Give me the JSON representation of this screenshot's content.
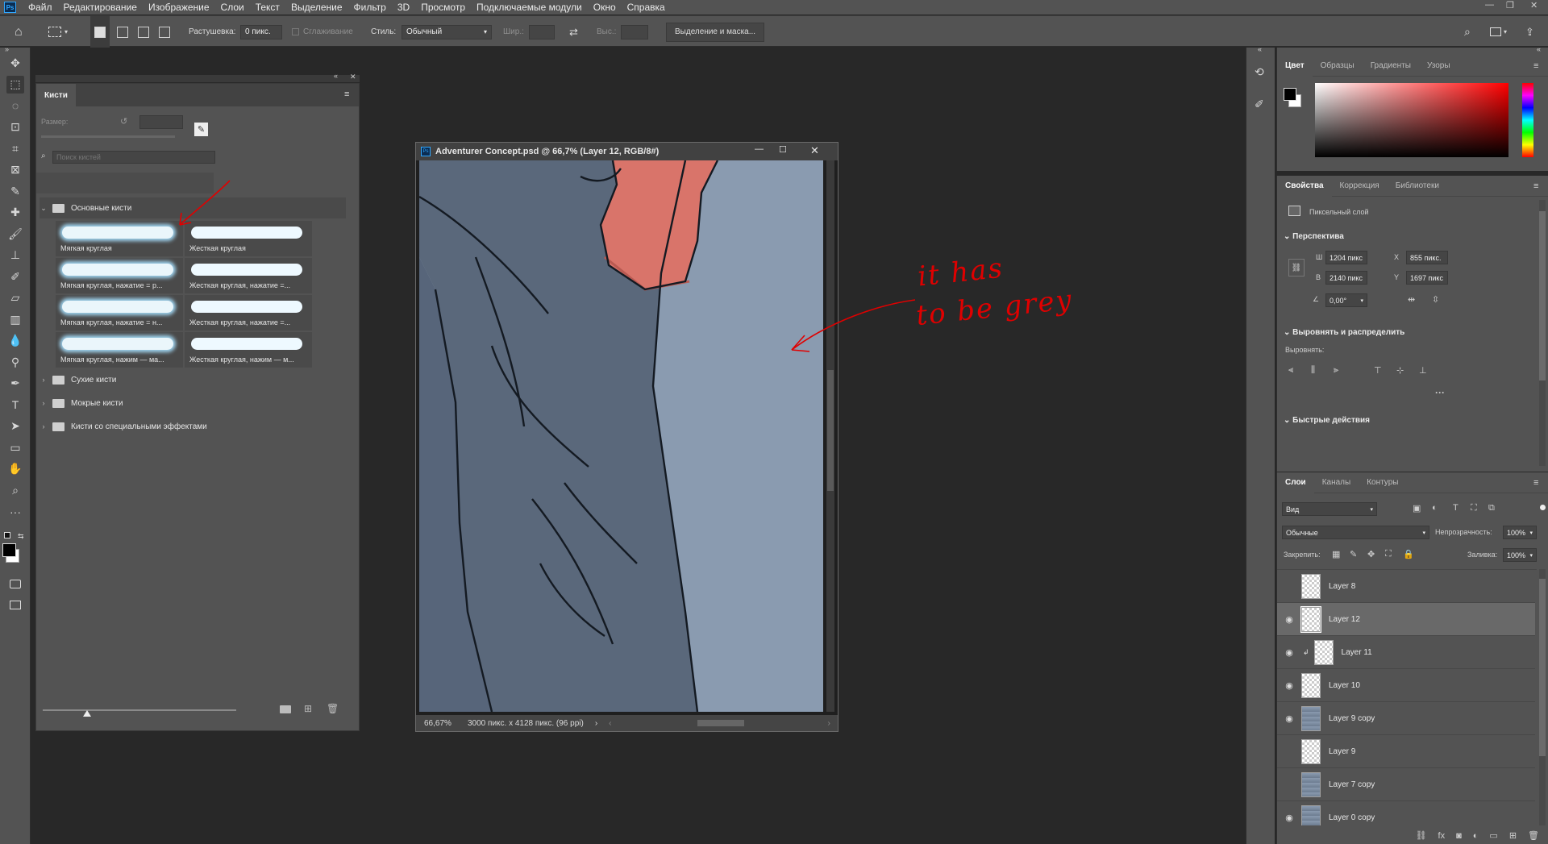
{
  "app": {
    "logo": "Ps"
  },
  "menu": [
    "Файл",
    "Редактирование",
    "Изображение",
    "Слои",
    "Текст",
    "Выделение",
    "Фильтр",
    "3D",
    "Просмотр",
    "Подключаемые модули",
    "Окно",
    "Справка"
  ],
  "options": {
    "feather_label": "Растушевка:",
    "feather_value": "0 пикс.",
    "antialias_label": "Сглаживание",
    "style_label": "Стиль:",
    "style_value": "Обычный",
    "width_label": "Шир.:",
    "height_label": "Выс.:",
    "select_mask_button": "Выделение и маска..."
  },
  "brushes_panel": {
    "tab": "Кисти",
    "size_label": "Размер:",
    "search_placeholder": "Поиск кистей",
    "main_group": "Основные кисти",
    "brushes": [
      {
        "name": "Мягкая круглая",
        "kind": "soft"
      },
      {
        "name": "Жесткая круглая",
        "kind": "hard"
      },
      {
        "name": "Мягкая круглая, нажатие = р...",
        "kind": "soft"
      },
      {
        "name": "Жесткая круглая, нажатие =...",
        "kind": "hard"
      },
      {
        "name": "Мягкая круглая, нажатие = н...",
        "kind": "soft"
      },
      {
        "name": "Жесткая круглая, нажатие =...",
        "kind": "hard"
      },
      {
        "name": "Мягкая круглая, нажим — ма...",
        "kind": "soft"
      },
      {
        "name": "Жесткая круглая, нажим — м...",
        "kind": "hard"
      }
    ],
    "groups": [
      "Сухие кисти",
      "Мокрые кисти",
      "Кисти со специальными эффектами"
    ]
  },
  "document": {
    "title": "Adventurer Concept.psd @ 66,7% (Layer 12, RGB/8#)",
    "zoom": "66,67%",
    "info": "3000 пикс. x 4128 пикс. (96 ppi)",
    "annotation_line1": "it has",
    "annotation_line2": "to be grey"
  },
  "color_panel": {
    "tabs": [
      "Цвет",
      "Образцы",
      "Градиенты",
      "Узоры"
    ],
    "accent": "#ff0000"
  },
  "properties_panel": {
    "tabs": [
      "Свойства",
      "Коррекция",
      "Библиотеки"
    ],
    "layer_type": "Пиксельный слой",
    "transform_title": "Перспектива",
    "w_label": "Ш",
    "w_value": "1204 пикс",
    "h_label": "В",
    "h_value": "2140 пикс",
    "x_label": "X",
    "x_value": "855 пикс.",
    "y_label": "Y",
    "y_value": "1697 пикс",
    "angle_value": "0,00°",
    "align_title": "Выровнять и распределить",
    "align_label": "Выровнять:",
    "quick_title": "Быстрые действия"
  },
  "layers_panel": {
    "tabs": [
      "Слои",
      "Каналы",
      "Контуры"
    ],
    "filter_value": "Вид",
    "blend_mode": "Обычные",
    "opacity_label": "Непрозрачность:",
    "opacity_value": "100%",
    "lock_label": "Закрепить:",
    "fill_label": "Заливка:",
    "fill_value": "100%",
    "layers": [
      {
        "name": "Layer 8",
        "visible": false,
        "selected": false,
        "clipped": false,
        "thumb": "empty"
      },
      {
        "name": "Layer 12",
        "visible": true,
        "selected": true,
        "clipped": false,
        "thumb": "empty"
      },
      {
        "name": "Layer 11",
        "visible": true,
        "selected": false,
        "clipped": true,
        "thumb": "empty"
      },
      {
        "name": "Layer 10",
        "visible": true,
        "selected": false,
        "clipped": false,
        "thumb": "empty"
      },
      {
        "name": "Layer 9 copy",
        "visible": true,
        "selected": false,
        "clipped": false,
        "thumb": "figure"
      },
      {
        "name": "Layer 9",
        "visible": false,
        "selected": false,
        "clipped": false,
        "thumb": "empty"
      },
      {
        "name": "Layer 7 copy",
        "visible": false,
        "selected": false,
        "clipped": false,
        "thumb": "figure"
      },
      {
        "name": "Layer 0 copy",
        "visible": true,
        "selected": false,
        "clipped": false,
        "thumb": "figure"
      }
    ]
  },
  "tools": [
    "move-icon",
    "marquee-icon",
    "lasso-icon",
    "object-select-icon",
    "crop-icon",
    "frame-icon",
    "eyedropper-icon",
    "healing-icon",
    "brush-icon",
    "stamp-icon",
    "history-brush-icon",
    "eraser-icon",
    "gradient-icon",
    "blur-icon",
    "dodge-icon",
    "pen-icon",
    "type-icon",
    "path-select-icon",
    "rectangle-icon",
    "hand-icon",
    "zoom-icon",
    "more-icon"
  ]
}
